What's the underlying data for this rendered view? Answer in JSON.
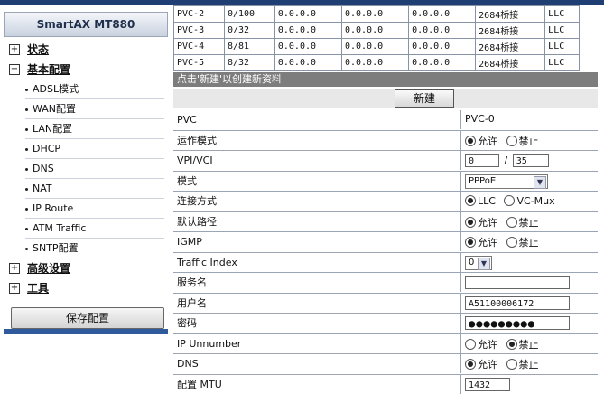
{
  "sidebar": {
    "title": "SmartAX MT880",
    "groups": [
      {
        "label": "状态",
        "expanded": false
      },
      {
        "label": "基本配置",
        "expanded": true,
        "items": [
          "ADSL模式",
          "WAN配置",
          "LAN配置",
          "DHCP",
          "DNS",
          "NAT",
          "IP Route",
          "ATM Traffic",
          "SNTP配置"
        ]
      },
      {
        "label": "高级设置",
        "expanded": false
      },
      {
        "label": "工具",
        "expanded": false
      }
    ],
    "save_label": "保存配置",
    "expand_glyph": "+",
    "collapse_glyph": "−"
  },
  "pvc_table": {
    "rows": [
      [
        "PVC-2",
        "0/100",
        "0.0.0.0",
        "0.0.0.0",
        "0.0.0.0",
        "2684桥接",
        "LLC"
      ],
      [
        "PVC-3",
        "0/32",
        "0.0.0.0",
        "0.0.0.0",
        "0.0.0.0",
        "2684桥接",
        "LLC"
      ],
      [
        "PVC-4",
        "8/81",
        "0.0.0.0",
        "0.0.0.0",
        "0.0.0.0",
        "2684桥接",
        "LLC"
      ],
      [
        "PVC-5",
        "8/32",
        "0.0.0.0",
        "0.0.0.0",
        "0.0.0.0",
        "2684桥接",
        "LLC"
      ]
    ]
  },
  "hint": "点击'新建'以创建新资料",
  "new_label": "新建",
  "form": {
    "pvc": {
      "label": "PVC",
      "value": "PVC-0"
    },
    "run_mode": {
      "label": "运作模式",
      "opt_on": "允许",
      "opt_off": "禁止"
    },
    "vpi_vci": {
      "label": "VPI/VCI",
      "vpi": "0",
      "sep": "/",
      "vci": "35"
    },
    "mode": {
      "label": "模式",
      "value": "PPPoE"
    },
    "conn": {
      "label": "连接方式",
      "opt_a": "LLC",
      "opt_b": "VC-Mux"
    },
    "default_route": {
      "label": "默认路径",
      "opt_on": "允许",
      "opt_off": "禁止"
    },
    "igmp": {
      "label": "IGMP",
      "opt_on": "允许",
      "opt_off": "禁止"
    },
    "traffic": {
      "label": "Traffic Index",
      "value": "0"
    },
    "service": {
      "label": "服务名",
      "value": ""
    },
    "user": {
      "label": "用户名",
      "value": "A51100006172"
    },
    "password": {
      "label": "密码",
      "value": "●●●●●●●●●"
    },
    "ip_unnumber": {
      "label": "IP Unnumber",
      "opt_on": "允许",
      "opt_off": "禁止"
    },
    "dns": {
      "label": "DNS",
      "opt_on": "允许",
      "opt_off": "禁止"
    },
    "mtu": {
      "label": "配置 MTU",
      "value": "1432"
    }
  }
}
